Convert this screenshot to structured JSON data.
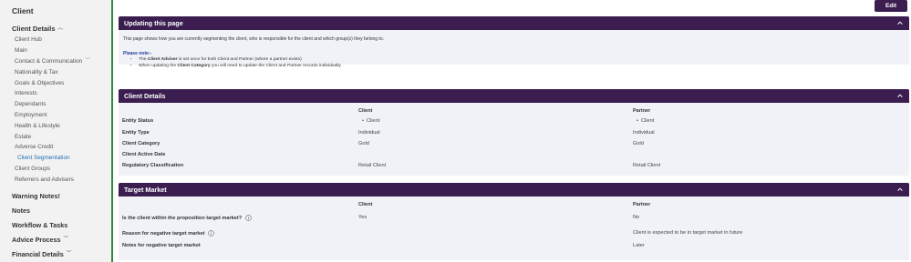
{
  "sidebar": {
    "title": "Client",
    "group_label": "Client Details",
    "items": [
      {
        "label": "Client Hub"
      },
      {
        "label": "Main"
      },
      {
        "label": "Contact & Communication"
      },
      {
        "label": "Nationality & Tax"
      },
      {
        "label": "Goals & Objectives"
      },
      {
        "label": "Interests"
      },
      {
        "label": "Dependants"
      },
      {
        "label": "Employment"
      },
      {
        "label": "Health & Lifestyle"
      },
      {
        "label": "Estate"
      },
      {
        "label": "Adverse Credit"
      },
      {
        "label": "Client Segmentation"
      },
      {
        "label": "Client Groups"
      },
      {
        "label": "Referrers and Advisers"
      }
    ],
    "sections": [
      {
        "label": "Warning Notes!"
      },
      {
        "label": "Notes"
      },
      {
        "label": "Workflow & Tasks"
      },
      {
        "label": "Advice Process"
      },
      {
        "label": "Financial Details"
      }
    ]
  },
  "toolbar": {
    "edit_label": "Edit"
  },
  "updating": {
    "title": "Updating this page",
    "intro": "This page shows how you are currently segmenting the client, who is responsible for the client and which group(s) they belong to.",
    "note_title": "Please note:-",
    "note1_pre": "The ",
    "note1_bold": "Client Adviser",
    "note1_post": " is set once for both Client and Partner (where a partner exists)",
    "note2_pre": "When updating the ",
    "note2_bold": "Client Category",
    "note2_post": " you will need to update the Client and Partner records individually"
  },
  "client_details": {
    "title": "Client Details",
    "client_header": "Client",
    "partner_header": "Partner",
    "rows": [
      {
        "label": "Entity Status",
        "client": "Client",
        "partner": "Client"
      },
      {
        "label": "Entity Type",
        "client": "Individual",
        "partner": "Individual"
      },
      {
        "label": "Client Category",
        "client": "Gold",
        "partner": "Gold"
      },
      {
        "label": "Client Active Date",
        "client": "",
        "partner": ""
      },
      {
        "label": "Regulatory Classification",
        "client": "Retail Client",
        "partner": "Retail Client"
      }
    ]
  },
  "target_market": {
    "title": "Target Market",
    "client_header": "Client",
    "partner_header": "Partner",
    "rows": [
      {
        "label": "Is the client within the proposition target market?",
        "client": "Yes",
        "partner": "No"
      },
      {
        "label": "Reason for negative target market",
        "client": "",
        "partner": "Client is expected to be in target market in future"
      },
      {
        "label": "Notes for negative target market",
        "client": "",
        "partner": "Later"
      }
    ]
  },
  "colors": {
    "header_bg": "#3b1e4f",
    "panel_bg": "#f1f2f7",
    "sidebar_bg": "#f2f2f2",
    "active_link": "#1f6fb2",
    "accent_border": "#2e8b3e"
  }
}
